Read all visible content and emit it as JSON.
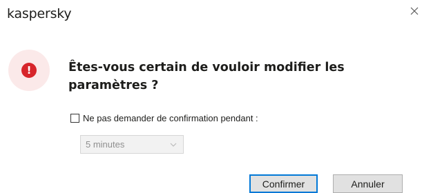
{
  "header": {
    "brand": "kaspersky",
    "close_icon": "close-icon"
  },
  "alert": {
    "icon": "exclamation-icon",
    "glyph": "!",
    "badge_color": "#fbe9e9",
    "icon_color": "#d7252b",
    "question": "Êtes-vous certain de vouloir modifier les paramètres ?"
  },
  "options": {
    "dont_ask_checked": false,
    "dont_ask_label": "Ne pas demander de confirmation pendant :",
    "duration_value": "5 minutes",
    "duration_disabled": true
  },
  "buttons": {
    "confirm_label": "Confirmer",
    "cancel_label": "Annuler",
    "focus_color": "#0078d7"
  }
}
